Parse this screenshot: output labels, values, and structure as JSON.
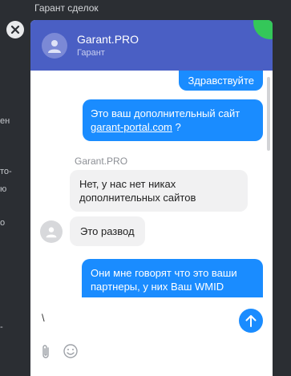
{
  "background": {
    "title": "Гарант сделок",
    "fragments": [
      "ен",
      "то-",
      "ю",
      "о",
      "-"
    ]
  },
  "chat": {
    "header": {
      "name": "Garant.PRO",
      "subtitle": "Гарант",
      "accent_color": "#4a5fc4",
      "online_color": "#34c759"
    },
    "messages": [
      {
        "dir": "out",
        "text": "Здравствуйте"
      },
      {
        "dir": "out",
        "text_before": "Это ваш дополнительный сайт",
        "link": "garant-portal.com",
        "text_after": " ?"
      },
      {
        "dir": "in",
        "sender": "Garant.PRO",
        "text": "Нет, у нас нет никах дополнительных сайтов"
      },
      {
        "dir": "in",
        "text": "Это развод"
      },
      {
        "dir": "out",
        "text": "Они мне говорят что это ваши партнеры, у них Ваш WMID"
      }
    ],
    "composer": {
      "input_value": "\\",
      "send_icon": "arrow-up-icon",
      "attach_icon": "paperclip-icon",
      "emoji_icon": "smiley-icon"
    }
  }
}
